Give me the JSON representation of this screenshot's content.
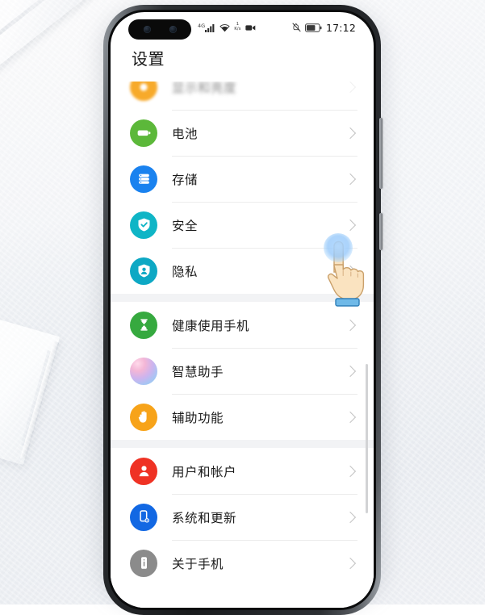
{
  "status_bar": {
    "network_generation": "4G",
    "signal_icon": "signal-bars-icon",
    "wifi_icon": "wifi-icon",
    "data_rate_value": "1",
    "data_rate_unit": "K/s",
    "video_icon": "video-recording-icon",
    "mute_icon": "bell-muted-icon",
    "battery_icon": "battery-icon",
    "clock": "17:12"
  },
  "header": {
    "title": "设置"
  },
  "colors": {
    "battery_green": "#5cb83a",
    "storage_blue": "#1a82ef",
    "security_teal": "#0fb5c6",
    "privacy_teal": "#0da8c4",
    "health_green": "#36a93f",
    "assistant_gradient": "#f0a8c8",
    "accessibility_orange": "#f7a319",
    "accounts_red": "#ef3224",
    "system_blue": "#1268e3",
    "about_gray": "#8b8b8b",
    "tap_ripple_blue": "#96c8fa",
    "cursor_skin": "#f9e2bf",
    "cursor_band": "#63b3e8"
  },
  "settings_groups": [
    {
      "rows": [
        {
          "label": "显示和亮度",
          "icon": "brightness-icon",
          "icon_color": "#f7a319",
          "clipped": true
        },
        {
          "label": "电池",
          "icon": "battery-circle-icon",
          "icon_color": "#5cb83a"
        },
        {
          "label": "存储",
          "icon": "storage-stack-icon",
          "icon_color": "#1a82ef"
        },
        {
          "label": "安全",
          "icon": "shield-check-icon",
          "icon_color": "#0fb5c6"
        },
        {
          "label": "隐私",
          "icon": "shield-person-icon",
          "icon_color": "#0da8c4"
        }
      ]
    },
    {
      "rows": [
        {
          "label": "健康使用手机",
          "icon": "hourglass-icon",
          "icon_color": "#36a93f"
        },
        {
          "label": "智慧助手",
          "icon": "smart-assistant-orb-icon",
          "icon_color": "#c8a8e8"
        },
        {
          "label": "辅助功能",
          "icon": "hand-palm-icon",
          "icon_color": "#f7a319"
        }
      ]
    },
    {
      "rows": [
        {
          "label": "用户和帐户",
          "icon": "user-account-icon",
          "icon_color": "#ef3224"
        },
        {
          "label": "系统和更新",
          "icon": "phone-update-icon",
          "icon_color": "#1268e3",
          "tapped": true
        },
        {
          "label": "关于手机",
          "icon": "phone-info-icon",
          "icon_color": "#8b8b8b"
        }
      ]
    }
  ],
  "cursor": {
    "type": "tap-hand-cursor",
    "target_row_label": "系统和更新"
  }
}
